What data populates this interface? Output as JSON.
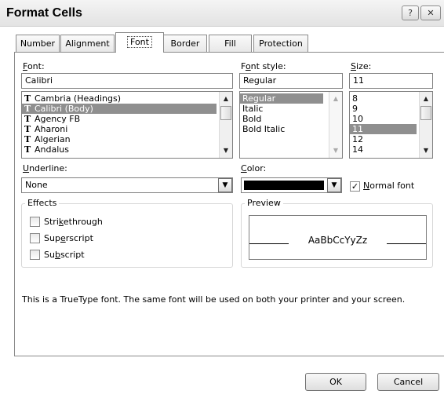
{
  "window": {
    "title": "Format Cells",
    "help_btn": "?",
    "close_btn": "✕"
  },
  "tabs": [
    {
      "label": "Number"
    },
    {
      "label": "Alignment"
    },
    {
      "label": "Font",
      "active": true
    },
    {
      "label": "Border"
    },
    {
      "label": "Fill"
    },
    {
      "label": "Protection"
    }
  ],
  "font": {
    "label": "Font:",
    "value": "Calibri",
    "items": [
      "Cambria (Headings)",
      "Calibri (Body)",
      "Agency FB",
      "Aharoni",
      "Algerian",
      "Andalus"
    ],
    "selected": "Calibri (Body)"
  },
  "font_style": {
    "label": "Font style:",
    "value": "Regular",
    "items": [
      "Regular",
      "Italic",
      "Bold",
      "Bold Italic"
    ],
    "selected": "Regular"
  },
  "size": {
    "label": "Size:",
    "value": "11",
    "items": [
      "8",
      "9",
      "10",
      "11",
      "12",
      "14"
    ],
    "selected": "11"
  },
  "underline": {
    "label": "Underline:",
    "value": "None"
  },
  "color": {
    "label": "Color:",
    "swatch": "#000000"
  },
  "normal_font": {
    "label": "Normal font",
    "checked": true
  },
  "effects": {
    "label": "Effects",
    "items": [
      {
        "label": "Strikethrough",
        "checked": false
      },
      {
        "label": "Superscript",
        "checked": false
      },
      {
        "label": "Subscript",
        "checked": false
      }
    ]
  },
  "preview": {
    "label": "Preview",
    "sample": "AaBbCcYyZz"
  },
  "info_text": "This is a TrueType font.  The same font will be used on both your printer and your screen.",
  "buttons": {
    "ok": "OK",
    "cancel": "Cancel"
  }
}
